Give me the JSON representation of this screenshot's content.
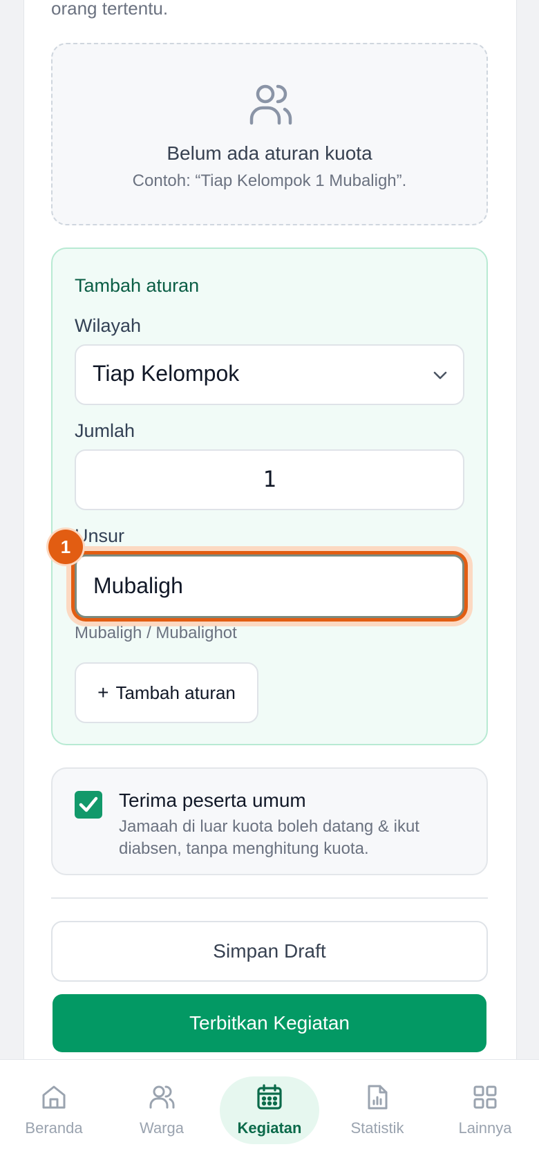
{
  "top_text": "orang tertentu.",
  "empty_state": {
    "title": "Belum ada aturan kuota",
    "subtitle": "Contoh: “Tiap Kelompok 1 Mubaligh”.",
    "icon": "users-icon"
  },
  "rule_form": {
    "title": "Tambah aturan",
    "wilayah_label": "Wilayah",
    "wilayah_value": "Tiap Kelompok",
    "jumlah_label": "Jumlah",
    "jumlah_value": "1",
    "unsur_label": "Unsur",
    "unsur_value": "Mubaligh",
    "unsur_hint": "Mubaligh / Mubalighot",
    "add_button": "Tambah aturan",
    "highlight_badge": "1"
  },
  "public_option": {
    "checked": true,
    "title": "Terima peserta umum",
    "description": "Jamaah di luar kuota boleh datang & ikut diabsen, tanpa menghitung kuota."
  },
  "actions": {
    "draft": "Simpan Draft",
    "publish": "Terbitkan Kegiatan"
  },
  "bottom_nav": [
    {
      "label": "Beranda",
      "icon": "home-icon"
    },
    {
      "label": "Warga",
      "icon": "users-icon"
    },
    {
      "label": "Kegiatan",
      "icon": "calendar-icon",
      "active": true
    },
    {
      "label": "Statistik",
      "icon": "chart-file-icon"
    },
    {
      "label": "Lainnya",
      "icon": "grid-icon"
    }
  ],
  "colors": {
    "primary": "#039964",
    "accent_highlight": "#e25d12",
    "rule_bg": "#f1fbf7"
  }
}
